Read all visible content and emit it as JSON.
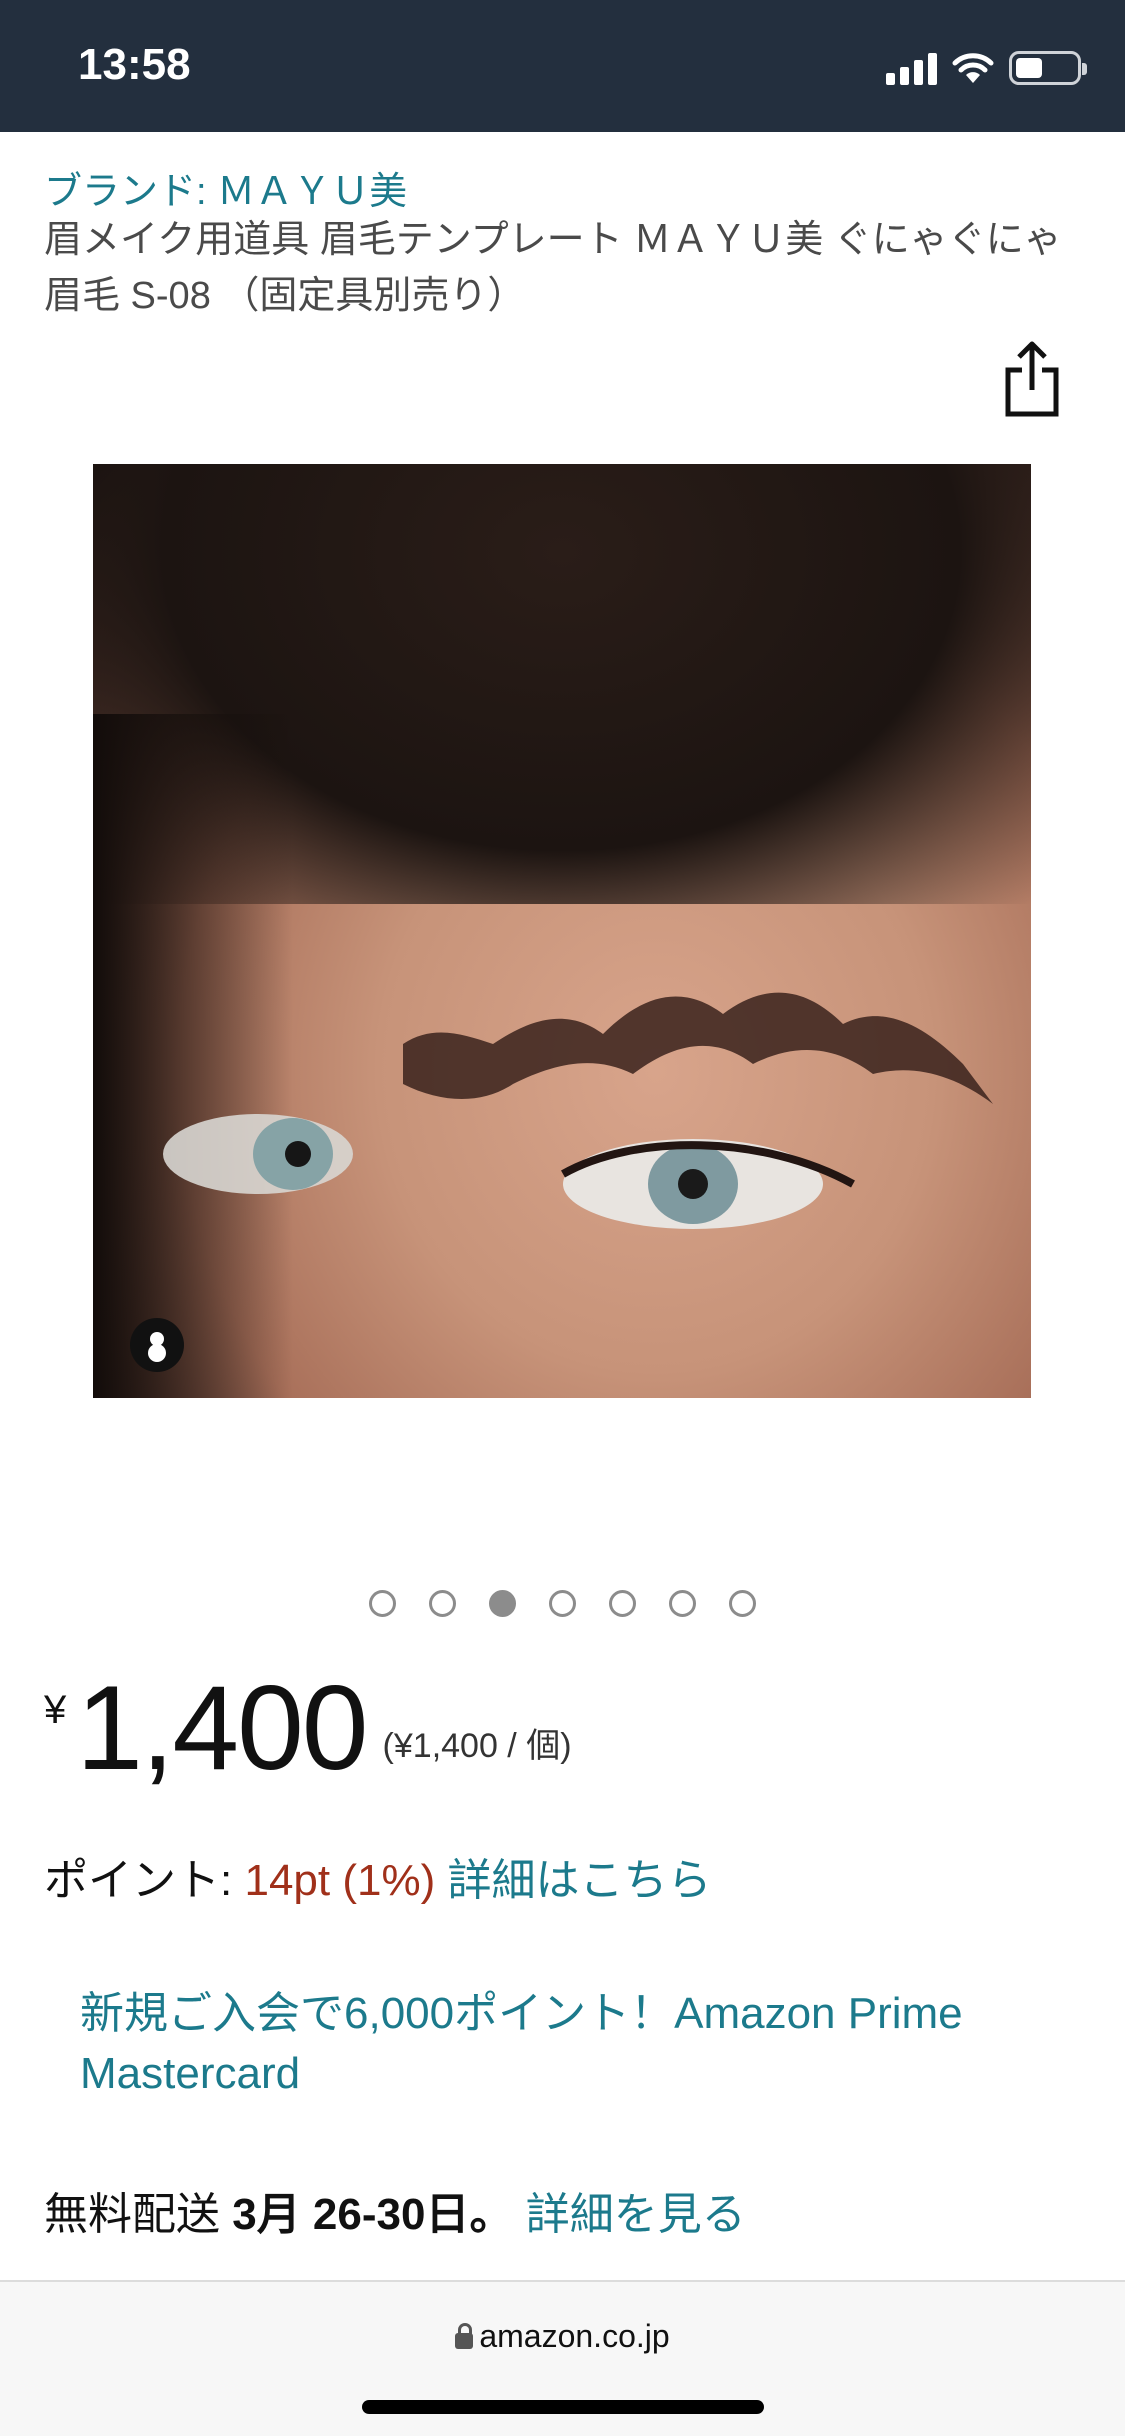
{
  "status_bar": {
    "time": "13:58",
    "icons": [
      "signal-icon",
      "wifi-icon",
      "battery-icon"
    ],
    "battery_level": 0.45
  },
  "product": {
    "brand": "ブランド: ＭＡＹＵ美",
    "title": "眉メイク用道具 眉毛テンプレート ＭＡＹＵ美 ぐにゃぐにゃ眉毛 S-08 （固定具別売り）"
  },
  "gallery": {
    "total_images": 7,
    "active_index": 2
  },
  "price": {
    "currency": "¥",
    "amount": "1,400",
    "unit_price": "(¥1,400 / 個)"
  },
  "points": {
    "label": "ポイント:",
    "value": "14pt",
    "percent": "(1%)",
    "details_link": "詳細はこちら"
  },
  "promo": {
    "text": "新規ご入会で6,000ポイント！Amazon Prime Mastercard"
  },
  "delivery": {
    "label": "無料配送",
    "date": "3月 26-30日。",
    "details_link": "詳細を見る"
  },
  "browser": {
    "url": "amazon.co.jp"
  },
  "colors": {
    "status_bar_bg": "#232f3e",
    "link": "#1c7a8c",
    "points": "#a0301a"
  }
}
